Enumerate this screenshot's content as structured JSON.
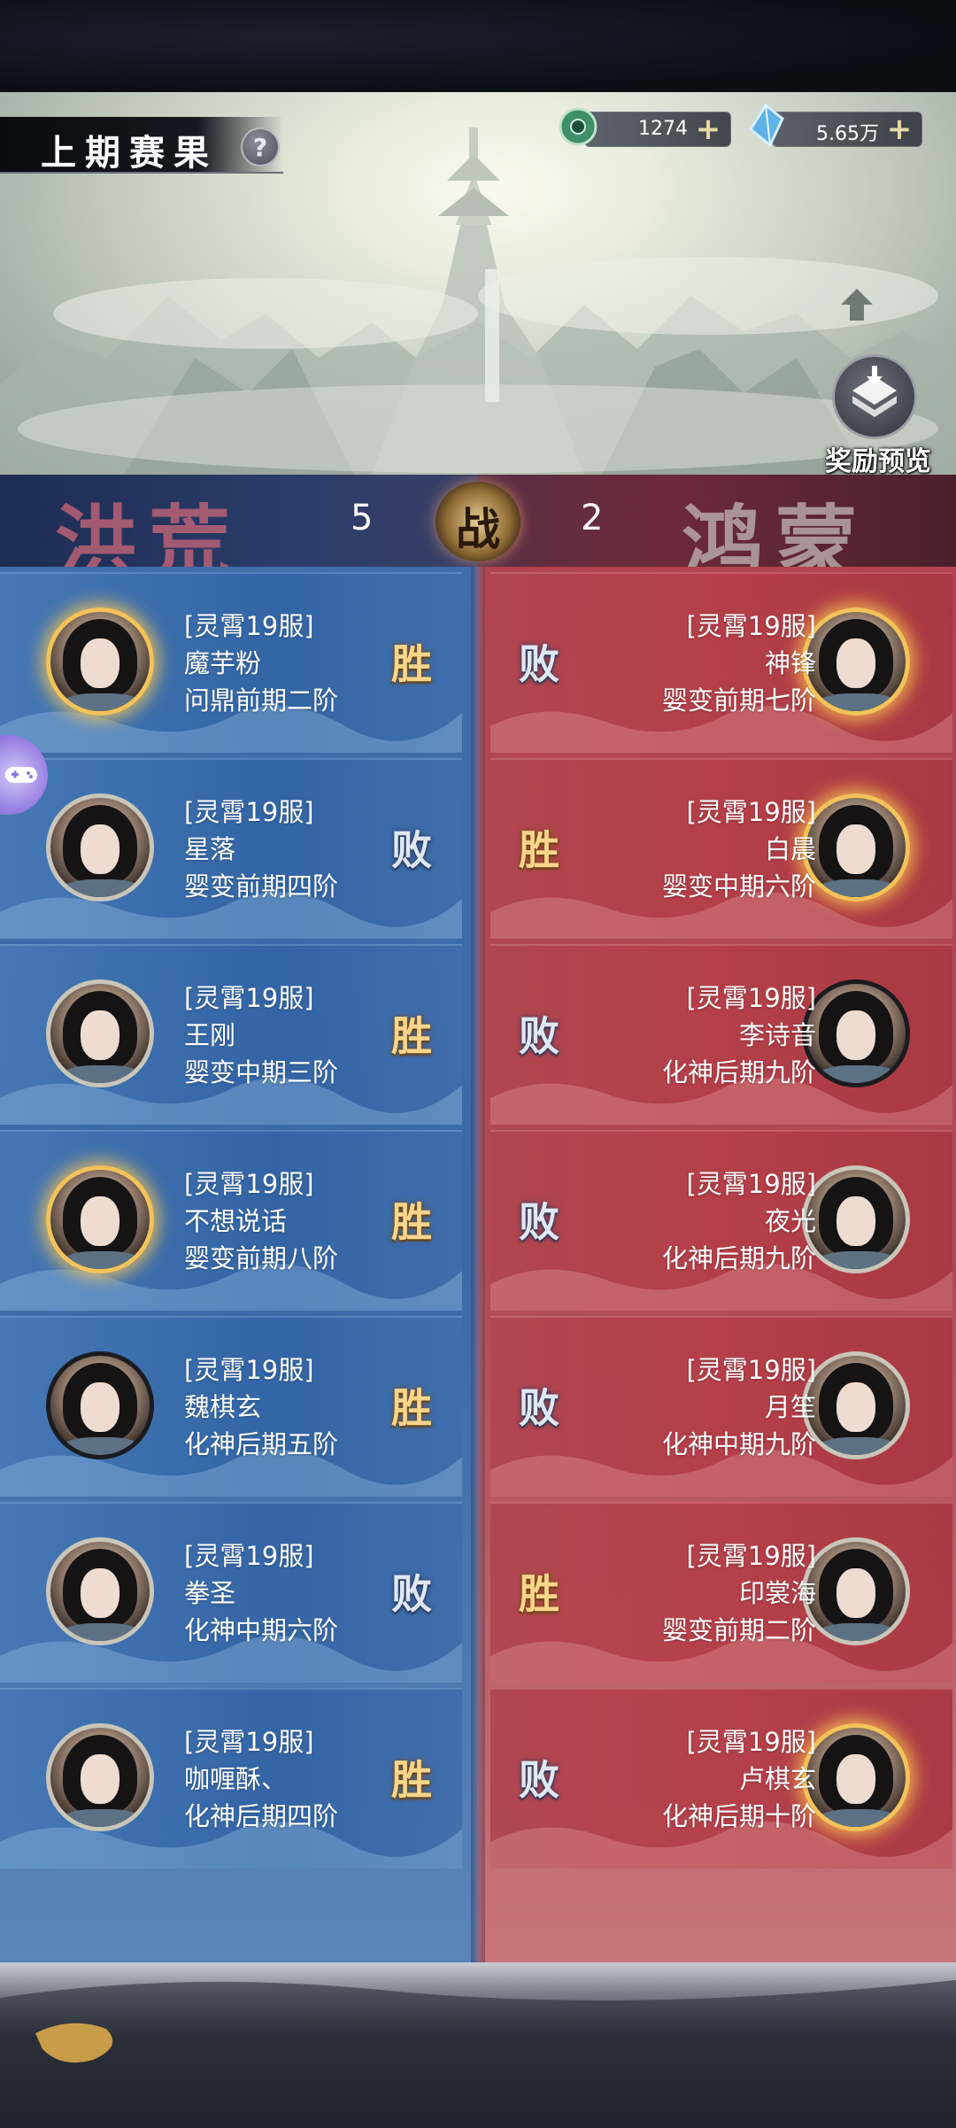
{
  "header": {
    "title": "上期赛果",
    "help_glyph": "?",
    "currencies": [
      {
        "icon": "jade-coin-icon",
        "value": "1274",
        "plus": "+"
      },
      {
        "icon": "spirit-crystal-icon",
        "value": "5.65万",
        "plus": "+"
      }
    ],
    "reward_preview_label": "奖励预览"
  },
  "versus": {
    "left_team": "洪荒",
    "right_team": "鸿蒙",
    "left_score": "5",
    "right_score": "2",
    "emblem": "战"
  },
  "matches": [
    {
      "left": {
        "server": "[灵霄19服]",
        "name": "魔芋粉",
        "rank": "问鼎前期二阶",
        "result": "胜"
      },
      "right": {
        "server": "[灵霄19服]",
        "name": "神锋",
        "rank": "婴变前期七阶",
        "result": "败"
      }
    },
    {
      "left": {
        "server": "[灵霄19服]",
        "name": "星落",
        "rank": "婴变前期四阶",
        "result": "败"
      },
      "right": {
        "server": "[灵霄19服]",
        "name": "白晨",
        "rank": "婴变中期六阶",
        "result": "胜"
      }
    },
    {
      "left": {
        "server": "[灵霄19服]",
        "name": "王刚",
        "rank": "婴变中期三阶",
        "result": "胜"
      },
      "right": {
        "server": "[灵霄19服]",
        "name": "李诗音",
        "rank": "化神后期九阶",
        "result": "败"
      }
    },
    {
      "left": {
        "server": "[灵霄19服]",
        "name": "不想说话",
        "rank": "婴变前期八阶",
        "result": "胜"
      },
      "right": {
        "server": "[灵霄19服]",
        "name": "夜光",
        "rank": "化神后期九阶",
        "result": "败"
      }
    },
    {
      "left": {
        "server": "[灵霄19服]",
        "name": "魏棋玄",
        "rank": "化神后期五阶",
        "result": "胜"
      },
      "right": {
        "server": "[灵霄19服]",
        "name": "月笙",
        "rank": "化神中期九阶",
        "result": "败"
      }
    },
    {
      "left": {
        "server": "[灵霄19服]",
        "name": "拳圣",
        "rank": "化神中期六阶",
        "result": "败"
      },
      "right": {
        "server": "[灵霄19服]",
        "name": "印裳海",
        "rank": "婴变前期二阶",
        "result": "胜"
      }
    },
    {
      "left": {
        "server": "[灵霄19服]",
        "name": "咖喱酥、",
        "rank": "化神后期四阶",
        "result": "胜"
      },
      "right": {
        "server": "[灵霄19服]",
        "name": "卢棋玄",
        "rank": "化神后期十阶",
        "result": "败"
      }
    }
  ],
  "colors": {
    "left_team": "#3f6ea9",
    "right_team": "#b2444f",
    "win_text": "#f7d58a",
    "lose_text": "#dfe7f3"
  }
}
